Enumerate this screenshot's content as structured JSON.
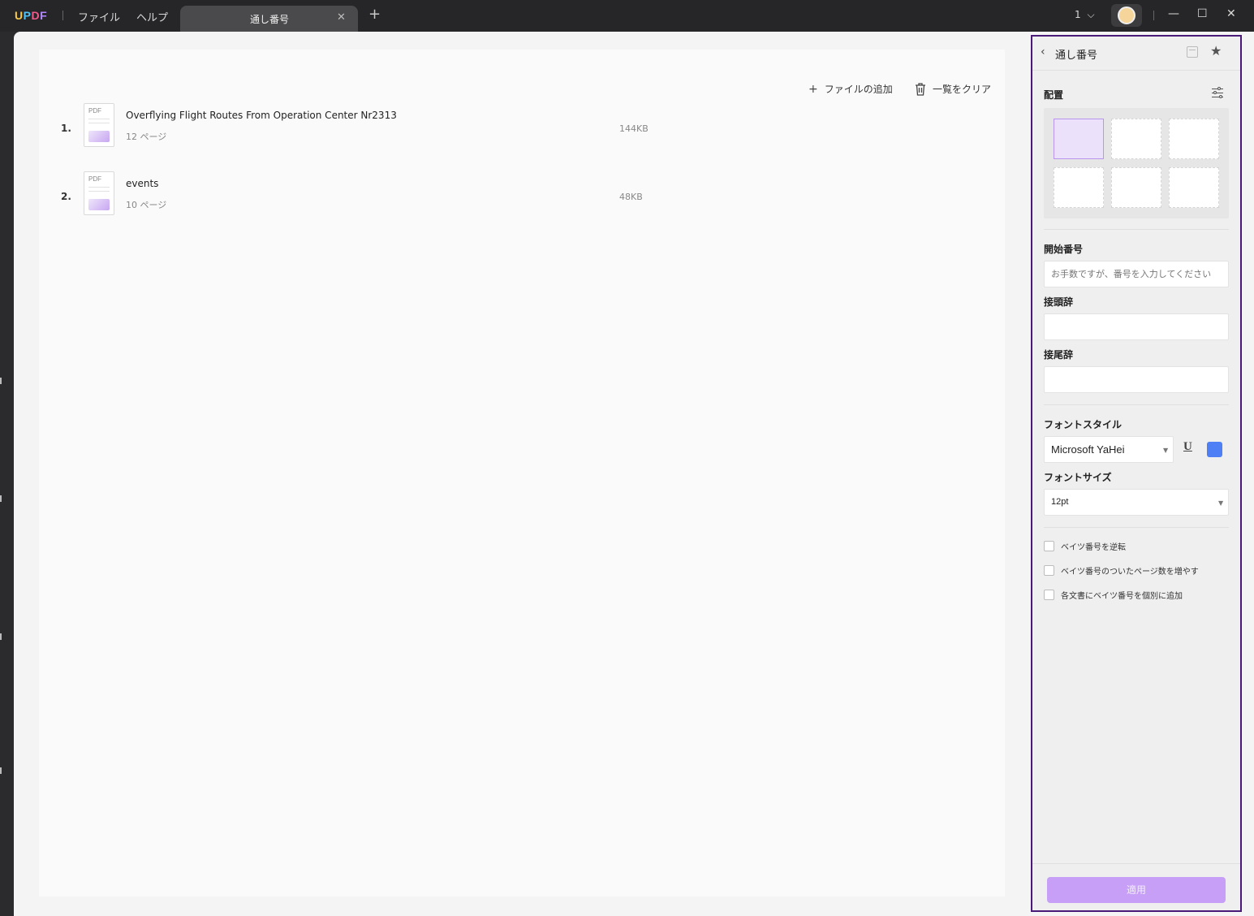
{
  "titlebar": {
    "logo": "UPDF",
    "menu_file": "ファイル",
    "menu_help": "ヘルプ",
    "tab_title": "通し番号",
    "tab_close": "✕",
    "tab_add": "+",
    "page_count": "1",
    "minimize": "—",
    "maximize": "☐",
    "close": "✕"
  },
  "toolbar": {
    "add_file": "ファイルの追加",
    "clear_list": "一覧をクリア"
  },
  "files": [
    {
      "index": "1.",
      "icon_label": "PDF",
      "name": "Overflying Flight Routes From Operation Center Nr2313",
      "pages": "12 ページ",
      "size": "144KB"
    },
    {
      "index": "2.",
      "icon_label": "PDF",
      "name": "events",
      "pages": "10 ページ",
      "size": "48KB"
    }
  ],
  "panel": {
    "title": "通し番号",
    "placement_label": "配置",
    "start_number_label": "開始番号",
    "start_number_placeholder": "お手数ですが、番号を入力してください",
    "prefix_label": "接頭辞",
    "suffix_label": "接尾辞",
    "font_style_label": "フォントスタイル",
    "font_family": "Microsoft YaHei",
    "underline": "U",
    "font_color": "#4f7ff5",
    "font_size_label": "フォントサイズ",
    "font_size": "12pt",
    "checkbox_reverse": "ベイツ番号を逆転",
    "checkbox_increase": "ベイツ番号のついたページ数を増やす",
    "checkbox_individual": "各文書にベイツ番号を個別に追加",
    "apply": "適用",
    "selected_position": "top-left"
  }
}
